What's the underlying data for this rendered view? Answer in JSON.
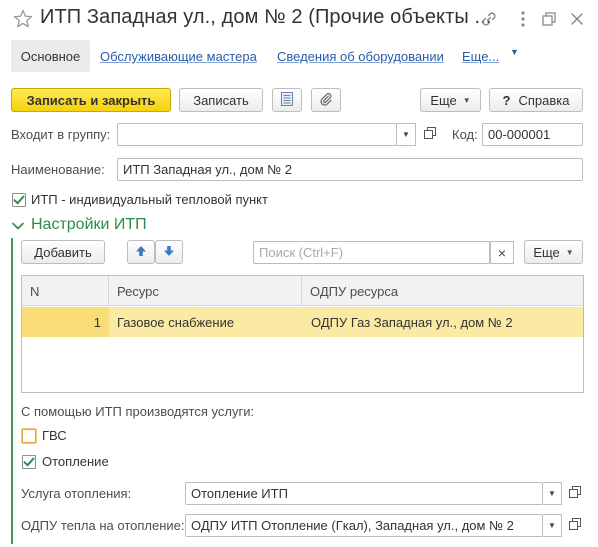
{
  "window": {
    "title": "ИТП Западная ул., дом № 2 (Прочие объекты ..."
  },
  "nav": {
    "tabs": [
      {
        "label": "Основное"
      },
      {
        "label": "Обслуживающие мастера"
      },
      {
        "label": "Сведения об оборудовании"
      },
      {
        "label": "Еще..."
      }
    ]
  },
  "toolbar": {
    "save_close": "Записать и закрыть",
    "save": "Записать",
    "more": "Еще",
    "help": "Справка",
    "help_glyph": "?"
  },
  "form": {
    "group_label": "Входит в группу:",
    "group_value": "",
    "code_label": "Код:",
    "code_value": "00-000001",
    "name_label": "Наименование:",
    "name_value": "ИТП Западная ул., дом № 2",
    "itp_checkbox_label": "ИТП - индивидуальный тепловой пункт",
    "itp_checked": true
  },
  "itp_settings": {
    "title": "Настройки ИТП",
    "add_button": "Добавить",
    "search_placeholder": "Поиск (Ctrl+F)",
    "clear_glyph": "×",
    "more": "Еще",
    "table": {
      "columns": [
        "N",
        "Ресурс",
        "ОДПУ ресурса"
      ],
      "rows": [
        {
          "n": "1",
          "resource": "Газовое снабжение",
          "odpu": "ОДПУ Газ Западная ул., дом № 2"
        }
      ]
    },
    "services_label": "С помощью ИТП производятся услуги:",
    "gvs_label": "ГВС",
    "gvs_checked": false,
    "heating_label": "Отопление",
    "heating_checked": true,
    "heating_service_label": "Услуга отопления:",
    "heating_service_value": "Отопление ИТП",
    "odpu_heat_label": "ОДПУ тепла на отопление:",
    "odpu_heat_value": "ОДПУ ИТП Отопление (Гкал), Западная ул., дом № 2"
  },
  "colors": {
    "accent_green": "#2c8c48",
    "primary_button": "#f5d20a",
    "link": "#2a5ca8",
    "selected_row": "#fbeaa3"
  },
  "icons": {
    "favorite": "star-icon",
    "link": "link-icon",
    "more_vertical": "more-vertical-icon",
    "restore": "restore-window-icon",
    "close": "close-icon",
    "report": "report-icon",
    "attach": "paperclip-icon",
    "move_up": "arrow-up-icon",
    "move_down": "arrow-down-icon",
    "dropdown": "triangle-down-icon",
    "open": "open-form-icon"
  }
}
